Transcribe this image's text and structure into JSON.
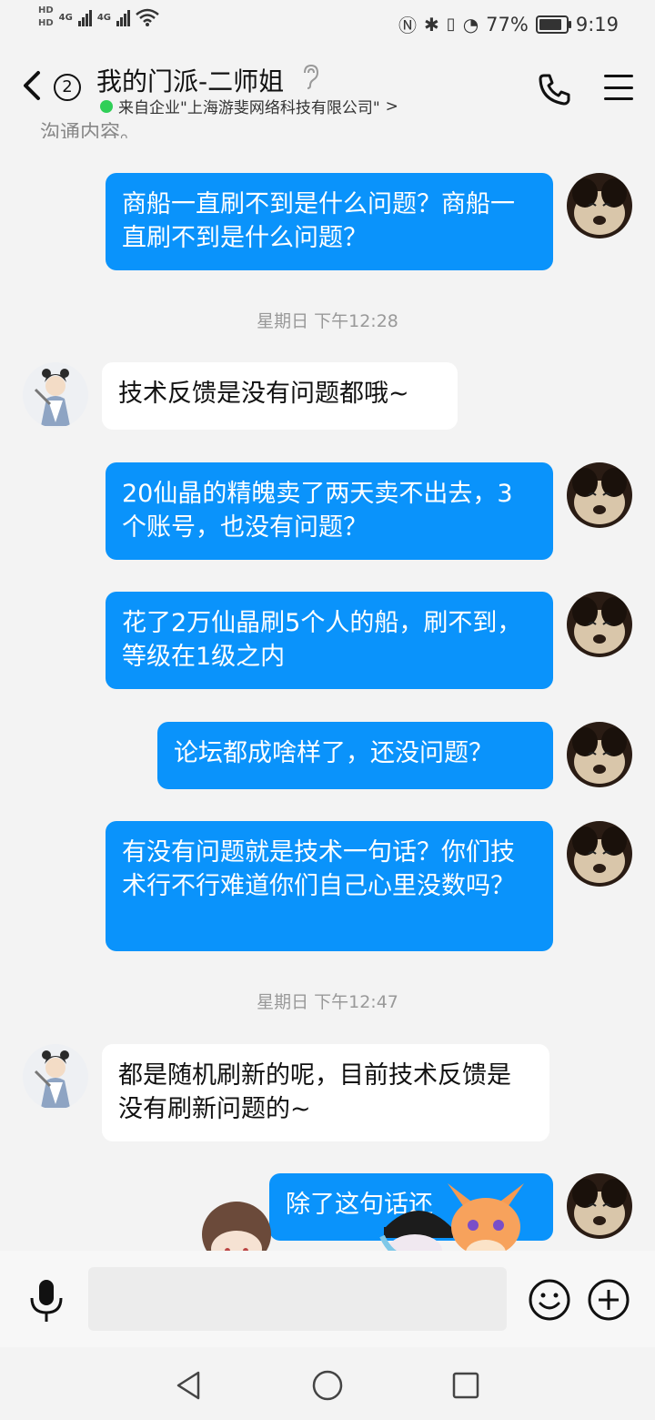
{
  "status": {
    "left_labels": [
      "HD",
      "HD"
    ],
    "sim1_net": "4G",
    "sim2_net": "4G",
    "battery_percent": "77%",
    "battery_level": 0.77,
    "time": "9:19"
  },
  "header": {
    "badge_count": "2",
    "title": "我的门派-二师姐",
    "subtitle": "来自企业\"上海游斐网络科技有限公司\"",
    "subtitle_chevron": ">"
  },
  "cut_text": "沟通内容。",
  "messages": [
    {
      "side": "sent",
      "text": "商船一直刷不到是什么问题？商船一直刷不到是什么问题？"
    },
    {
      "side": "time",
      "text": "星期日 下午12:28"
    },
    {
      "side": "recv",
      "text": "技术反馈是没有问题都哦~"
    },
    {
      "side": "sent",
      "text": "20仙晶的精魄卖了两天卖不出去，3个账号，也没有问题？"
    },
    {
      "side": "sent",
      "text": "花了2万仙晶刷5个人的船，刷不到，等级在1级之内"
    },
    {
      "side": "sent",
      "text": "论坛都成啥样了，还没问题？"
    },
    {
      "side": "sent",
      "text": "有没有问题就是技术一句话？你们技术行不行难道你们自己心里没数吗？"
    },
    {
      "side": "time",
      "text": "星期日 下午12:47"
    },
    {
      "side": "recv",
      "text": "都是随机刷新的呢，目前技术反馈是没有刷新问题的~"
    },
    {
      "side": "sent",
      "text": "除了这句话还"
    }
  ],
  "input": {
    "placeholder": ""
  },
  "colors": {
    "sent_bubble": "#0a93fb",
    "recv_bubble": "#ffffff",
    "online": "#2fcf57"
  }
}
